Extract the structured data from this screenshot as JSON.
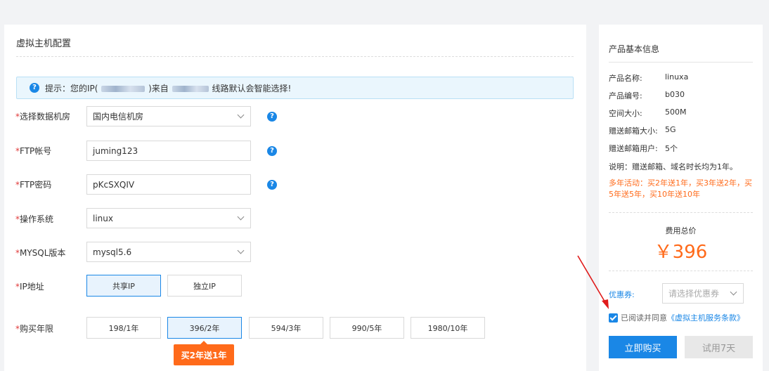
{
  "config": {
    "title": "虚拟主机配置",
    "tip_prefix": "提示：您的IP(",
    "tip_middle": ")来自",
    "tip_suffix": "线路默认会智能选择!",
    "datacenter": {
      "label": "选择数据机房",
      "value": "国内电信机房"
    },
    "ftp_user": {
      "label": "FTP帐号",
      "value": "juming123"
    },
    "ftp_pass": {
      "label": "FTP密码",
      "value": "pKcSXQIV"
    },
    "os": {
      "label": "操作系统",
      "value": "linux"
    },
    "mysql": {
      "label": "MYSQL版本",
      "value": "mysql5.6"
    },
    "ip": {
      "label": "IP地址",
      "options": [
        "共享IP",
        "独立IP"
      ],
      "selected": "共享IP"
    },
    "term": {
      "label": "购买年限",
      "options": [
        "198/1年",
        "396/2年",
        "594/3年",
        "990/5年",
        "1980/10年"
      ],
      "selected": "396/2年"
    },
    "promo_tag": "买2年送1年",
    "required_mark": "*",
    "help_glyph": "?"
  },
  "product": {
    "title": "产品基本信息",
    "rows": [
      {
        "key": "产品名称:",
        "value": "linuxa"
      },
      {
        "key": "产品编号:",
        "value": "b030"
      },
      {
        "key": "空间大小:",
        "value": "500M"
      },
      {
        "key": "赠送邮箱大小:",
        "value": "5G"
      },
      {
        "key": "赠送邮箱用户:",
        "value": "5个"
      }
    ],
    "description": "说明：赠送邮箱、域名时长均为1年。",
    "promo": "多年活动：买2年送1年，买3年送2年，买5年送5年，买10年送10年",
    "total_label": "费用总价",
    "total_price": "￥396",
    "coupon_label": "优惠券:",
    "coupon_placeholder": "请选择优惠券",
    "agree_text": "已阅读并同意",
    "agree_link": "《虚拟主机服务条款》",
    "buy_button": "立即购买",
    "trial_button": "试用7天"
  },
  "colors": {
    "accent": "#1a87e6",
    "promo": "#ff6a1a",
    "required": "#e03b3b",
    "arrow": "#e01b1b"
  }
}
